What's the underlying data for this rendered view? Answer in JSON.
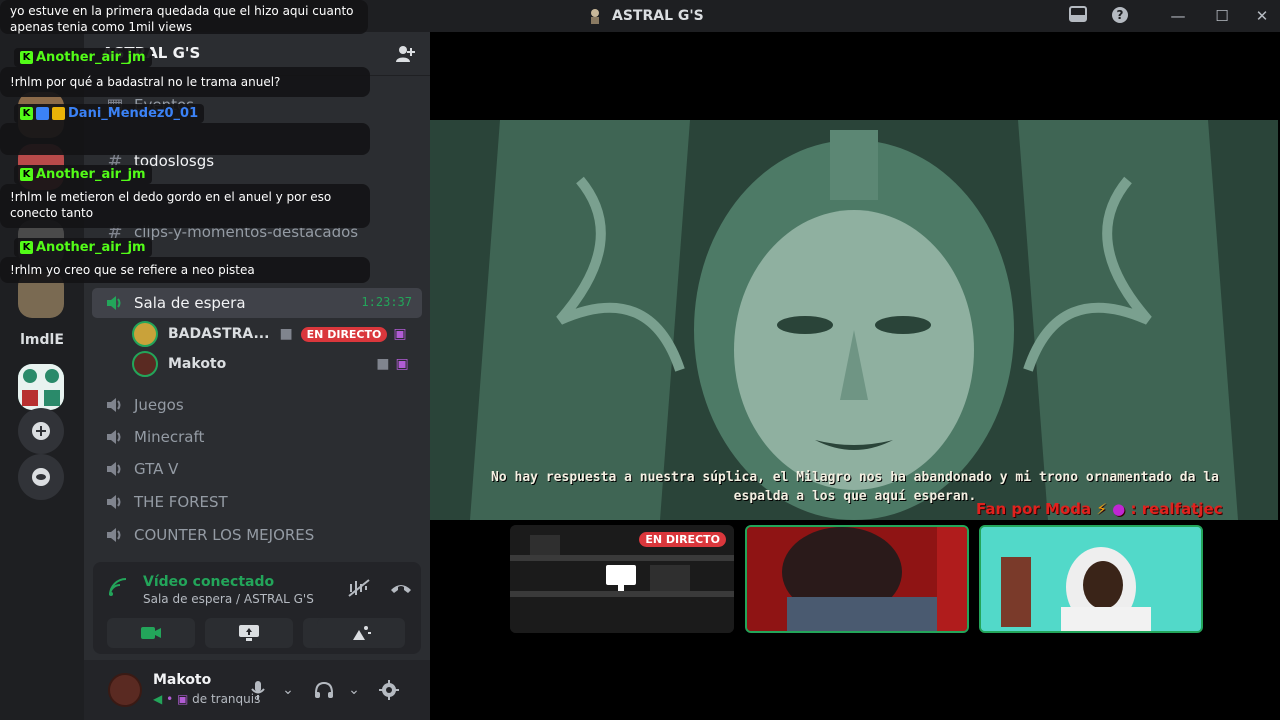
{
  "window": {
    "title": "ASTRAL G'S"
  },
  "rail": {
    "text_server": "lmdlE"
  },
  "guild": {
    "name": "ASTRAL G'S"
  },
  "channels": {
    "events_label": "Eventos",
    "text": [
      {
        "label": "todoslosgs"
      },
      {
        "label": "clips-y-momentos-destacados"
      }
    ],
    "active_voice": {
      "label": "Sala de espera",
      "timer": "1:23:37"
    },
    "voice_users": [
      {
        "name": "BADASTRA...",
        "live": "EN DIRECTO"
      },
      {
        "name": "Makoto"
      }
    ],
    "voice": [
      {
        "label": "Juegos"
      },
      {
        "label": "Minecraft"
      },
      {
        "label": "GTA V"
      },
      {
        "label": "THE FOREST"
      },
      {
        "label": "COUNTER LOS MEJORES"
      }
    ]
  },
  "voice_panel": {
    "status": "Vídeo conectado",
    "sub": "Sala de espera / ASTRAL G'S"
  },
  "user_panel": {
    "name": "Makoto",
    "status": "de tranquis"
  },
  "chat": [
    {
      "text_l1": "yo estuve en la primera quedada que el hizo aqui cuanto",
      "text_l2": "apenas tenia como 1mil views"
    },
    {
      "user": "Another_air_jm",
      "color": "#53fc18",
      "text": "!rhlm por qué a badastral no le trama anuel?"
    },
    {
      "user": "Dani_Mendez0_01",
      "color": "#3b82f6",
      "text": ""
    },
    {
      "user": "Another_air_jm",
      "color": "#53fc18",
      "text_l1": "!rhlm le metieron el dedo gordo en el anuel y por eso",
      "text_l2": "conecto tanto"
    },
    {
      "user": "Another_air_jm",
      "color": "#53fc18",
      "text": "!rhlm yo creo que se refiere a neo pistea"
    }
  ],
  "stream": {
    "subtitle_l1": "No hay respuesta a nuestra súplica, el Milagro nos ha abandonado y mi trono ornamentado da la",
    "subtitle_l2": "espalda a los que aquí esperan.",
    "fan_prefix": "Fan por Moda",
    "fan_handle": ": realfatjec",
    "tile_live": "EN DIRECTO"
  },
  "colors": {
    "accent_green": "#23a55a",
    "live_red": "#da373c",
    "kick_green": "#53fc18"
  }
}
